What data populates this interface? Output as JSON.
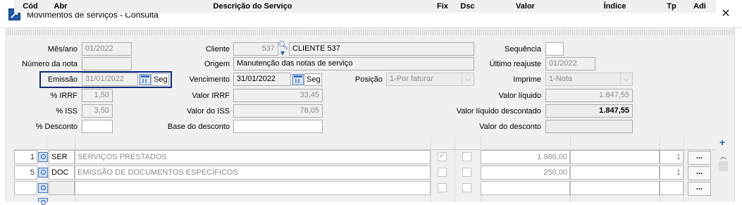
{
  "window": {
    "title": "Movimentos de serviços - Consulta",
    "close_icon": "close-icon"
  },
  "form": {
    "mes_ano": {
      "label": "Mês/ano",
      "value": "01/2022"
    },
    "numero_nota": {
      "label": "Número da nota",
      "value": ""
    },
    "emissao": {
      "label": "Emissão",
      "value": "31/01/2022",
      "day": "Seg"
    },
    "irrf_pct": {
      "label": "% IRRF",
      "value": "1,50"
    },
    "iss_pct": {
      "label": "% ISS",
      "value": "3,50"
    },
    "desconto_pct": {
      "label": "% Desconto",
      "value": ""
    },
    "cliente": {
      "label": "Cliente",
      "code": "537",
      "name": "CLIENTE 537"
    },
    "origem": {
      "label": "Origem",
      "value": "Manutenção das notas de serviço"
    },
    "vencimento": {
      "label": "Vencimento",
      "value": "31/01/2022",
      "day": "Seg"
    },
    "posicao": {
      "label": "Posição",
      "value": "1-Por faturar"
    },
    "valor_irrf": {
      "label": "Valor IRRF",
      "value": "33,45"
    },
    "valor_iss": {
      "label": "Valor do ISS",
      "value": "78,05"
    },
    "base_desconto": {
      "label": "Base do desconto",
      "value": ""
    },
    "sequencia": {
      "label": "Sequência",
      "value": ""
    },
    "ultimo_reajuste": {
      "label": "Último reajuste",
      "value": "01/2022"
    },
    "imprime": {
      "label": "Imprime",
      "value": "1-Nota"
    },
    "valor_liquido": {
      "label": "Valor líquido",
      "value": "1.847,55"
    },
    "valor_liquido_desc": {
      "label": "Valor líquido descontado",
      "value": "1.847,55"
    },
    "valor_desconto": {
      "label": "Valor do desconto",
      "value": ""
    }
  },
  "grid": {
    "headers": {
      "cod": "Cód",
      "abr": "Abr",
      "desc": "Descrição do Serviço",
      "fix": "Fix",
      "dsc": "Dsc",
      "valor": "Valor",
      "indice": "Índice",
      "tp": "Tp",
      "adi": "Adi"
    },
    "rows": [
      {
        "cod": "1",
        "abr": "SER",
        "desc": "SERVIÇOS PRESTADOS",
        "fix": true,
        "dsc": false,
        "valor": "1.980,00",
        "indice": "",
        "tp": "1",
        "adi": "..."
      },
      {
        "cod": "5",
        "abr": "DOC",
        "desc": "EMISSÃO DE DOCUMENTOS ESPECÍFICOS",
        "fix": false,
        "dsc": false,
        "valor": "250,00",
        "indice": "",
        "tp": "1",
        "adi": "..."
      },
      {
        "cod": "",
        "abr": "",
        "desc": "",
        "fix": false,
        "dsc": false,
        "valor": "",
        "indice": "",
        "tp": "",
        "adi": "..."
      }
    ],
    "add_icon": "+"
  }
}
